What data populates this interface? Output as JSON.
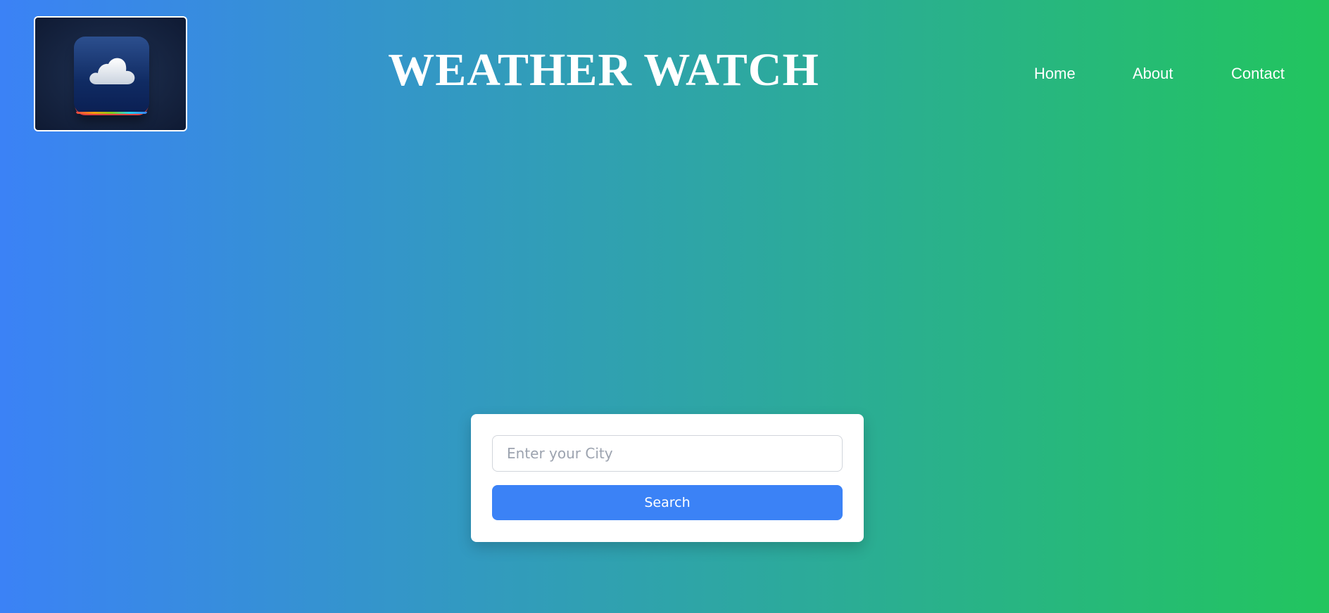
{
  "header": {
    "logo_icon": "cloud-app-icon",
    "title": "WEATHER WATCH"
  },
  "nav": {
    "items": [
      {
        "label": "Home"
      },
      {
        "label": "About"
      },
      {
        "label": "Contact"
      }
    ]
  },
  "search": {
    "value": "",
    "placeholder": "Enter your City",
    "button_label": "Search"
  },
  "colors": {
    "gradient_start": "#3b82f6",
    "gradient_end": "#22c55e",
    "button": "#3b82f6",
    "text": "#ffffff"
  }
}
